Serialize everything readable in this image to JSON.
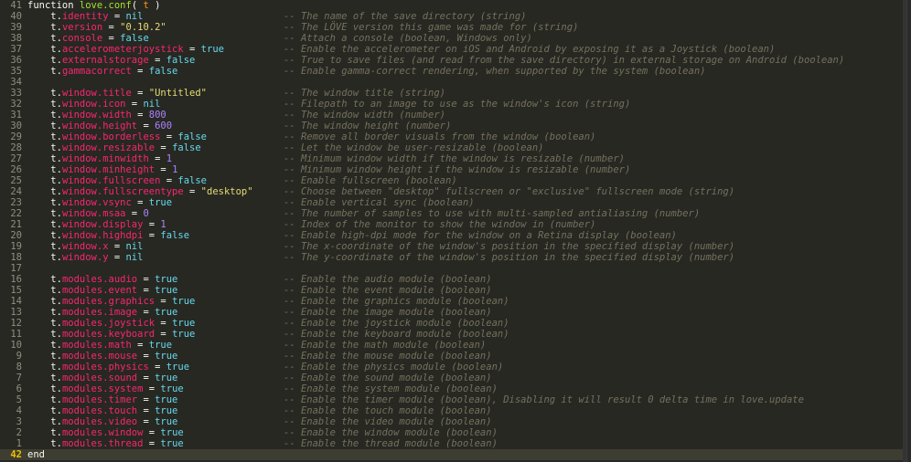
{
  "editor": {
    "lines": [
      {
        "n": "41",
        "parts": [
          {
            "c": "kw",
            "t": "function "
          },
          {
            "c": "fn",
            "t": "love.conf"
          },
          {
            "c": "kw",
            "t": "( "
          },
          {
            "c": "param",
            "t": "t"
          },
          {
            "c": "kw",
            "t": " )"
          }
        ],
        "comment": ""
      },
      {
        "n": "40",
        "parts": [
          {
            "c": "t",
            "t": "    t."
          },
          {
            "c": "key",
            "t": "identity"
          },
          {
            "c": "eq",
            "t": " = "
          },
          {
            "c": "nil",
            "t": "nil"
          }
        ],
        "comment": "-- The name of the save directory (string)"
      },
      {
        "n": "39",
        "parts": [
          {
            "c": "t",
            "t": "    t."
          },
          {
            "c": "key",
            "t": "version"
          },
          {
            "c": "eq",
            "t": " = "
          },
          {
            "c": "str",
            "t": "\"0.10.2\""
          }
        ],
        "comment": "-- The LÖVE version this game was made for (string)"
      },
      {
        "n": "38",
        "parts": [
          {
            "c": "t",
            "t": "    t."
          },
          {
            "c": "key",
            "t": "console"
          },
          {
            "c": "eq",
            "t": " = "
          },
          {
            "c": "lit",
            "t": "false"
          }
        ],
        "comment": "-- Attach a console (boolean, Windows only)"
      },
      {
        "n": "37",
        "parts": [
          {
            "c": "t",
            "t": "    t."
          },
          {
            "c": "key",
            "t": "accelerometerjoystick"
          },
          {
            "c": "eq",
            "t": " = "
          },
          {
            "c": "lit",
            "t": "true"
          }
        ],
        "comment": "-- Enable the accelerometer on iOS and Android by exposing it as a Joystick (boolean)"
      },
      {
        "n": "36",
        "parts": [
          {
            "c": "t",
            "t": "    t."
          },
          {
            "c": "key",
            "t": "externalstorage"
          },
          {
            "c": "eq",
            "t": " = "
          },
          {
            "c": "lit",
            "t": "false"
          }
        ],
        "comment": "-- True to save files (and read from the save directory) in external storage on Android (boolean)"
      },
      {
        "n": "35",
        "parts": [
          {
            "c": "t",
            "t": "    t."
          },
          {
            "c": "key",
            "t": "gammacorrect"
          },
          {
            "c": "eq",
            "t": " = "
          },
          {
            "c": "lit",
            "t": "false"
          }
        ],
        "comment": "-- Enable gamma-correct rendering, when supported by the system (boolean)"
      },
      {
        "n": "34",
        "parts": [],
        "comment": ""
      },
      {
        "n": "33",
        "parts": [
          {
            "c": "t",
            "t": "    t."
          },
          {
            "c": "key",
            "t": "window.title"
          },
          {
            "c": "eq",
            "t": " = "
          },
          {
            "c": "str",
            "t": "\"Untitled\""
          }
        ],
        "comment": "-- The window title (string)"
      },
      {
        "n": "32",
        "parts": [
          {
            "c": "t",
            "t": "    t."
          },
          {
            "c": "key",
            "t": "window.icon"
          },
          {
            "c": "eq",
            "t": " = "
          },
          {
            "c": "nil",
            "t": "nil"
          }
        ],
        "comment": "-- Filepath to an image to use as the window's icon (string)"
      },
      {
        "n": "31",
        "parts": [
          {
            "c": "t",
            "t": "    t."
          },
          {
            "c": "key",
            "t": "window.width"
          },
          {
            "c": "eq",
            "t": " = "
          },
          {
            "c": "num",
            "t": "800"
          }
        ],
        "comment": "-- The window width (number)"
      },
      {
        "n": "30",
        "parts": [
          {
            "c": "t",
            "t": "    t."
          },
          {
            "c": "key",
            "t": "window.height"
          },
          {
            "c": "eq",
            "t": " = "
          },
          {
            "c": "num",
            "t": "600"
          }
        ],
        "comment": "-- The window height (number)"
      },
      {
        "n": "29",
        "parts": [
          {
            "c": "t",
            "t": "    t."
          },
          {
            "c": "key",
            "t": "window.borderless"
          },
          {
            "c": "eq",
            "t": " = "
          },
          {
            "c": "lit",
            "t": "false"
          }
        ],
        "comment": "-- Remove all border visuals from the window (boolean)"
      },
      {
        "n": "28",
        "parts": [
          {
            "c": "t",
            "t": "    t."
          },
          {
            "c": "key",
            "t": "window.resizable"
          },
          {
            "c": "eq",
            "t": " = "
          },
          {
            "c": "lit",
            "t": "false"
          }
        ],
        "comment": "-- Let the window be user-resizable (boolean)"
      },
      {
        "n": "27",
        "parts": [
          {
            "c": "t",
            "t": "    t."
          },
          {
            "c": "key",
            "t": "window.minwidth"
          },
          {
            "c": "eq",
            "t": " = "
          },
          {
            "c": "num",
            "t": "1"
          }
        ],
        "comment": "-- Minimum window width if the window is resizable (number)"
      },
      {
        "n": "26",
        "parts": [
          {
            "c": "t",
            "t": "    t."
          },
          {
            "c": "key",
            "t": "window.minheight"
          },
          {
            "c": "eq",
            "t": " = "
          },
          {
            "c": "num",
            "t": "1"
          }
        ],
        "comment": "-- Minimum window height if the window is resizable (number)"
      },
      {
        "n": "25",
        "parts": [
          {
            "c": "t",
            "t": "    t."
          },
          {
            "c": "key",
            "t": "window.fullscreen"
          },
          {
            "c": "eq",
            "t": " = "
          },
          {
            "c": "lit",
            "t": "false"
          }
        ],
        "comment": "-- Enable fullscreen (boolean)"
      },
      {
        "n": "24",
        "parts": [
          {
            "c": "t",
            "t": "    t."
          },
          {
            "c": "key",
            "t": "window.fullscreentype"
          },
          {
            "c": "eq",
            "t": " = "
          },
          {
            "c": "str",
            "t": "\"desktop\""
          }
        ],
        "comment": "-- Choose between \"desktop\" fullscreen or \"exclusive\" fullscreen mode (string)"
      },
      {
        "n": "23",
        "parts": [
          {
            "c": "t",
            "t": "    t."
          },
          {
            "c": "key",
            "t": "window.vsync"
          },
          {
            "c": "eq",
            "t": " = "
          },
          {
            "c": "lit",
            "t": "true"
          }
        ],
        "comment": "-- Enable vertical sync (boolean)"
      },
      {
        "n": "22",
        "parts": [
          {
            "c": "t",
            "t": "    t."
          },
          {
            "c": "key",
            "t": "window.msaa"
          },
          {
            "c": "eq",
            "t": " = "
          },
          {
            "c": "num",
            "t": "0"
          }
        ],
        "comment": "-- The number of samples to use with multi-sampled antialiasing (number)"
      },
      {
        "n": "21",
        "parts": [
          {
            "c": "t",
            "t": "    t."
          },
          {
            "c": "key",
            "t": "window.display"
          },
          {
            "c": "eq",
            "t": " = "
          },
          {
            "c": "num",
            "t": "1"
          }
        ],
        "comment": "-- Index of the monitor to show the window in (number)"
      },
      {
        "n": "20",
        "parts": [
          {
            "c": "t",
            "t": "    t."
          },
          {
            "c": "key",
            "t": "window.highdpi"
          },
          {
            "c": "eq",
            "t": " = "
          },
          {
            "c": "lit",
            "t": "false"
          }
        ],
        "comment": "-- Enable high-dpi mode for the window on a Retina display (boolean)"
      },
      {
        "n": "19",
        "parts": [
          {
            "c": "t",
            "t": "    t."
          },
          {
            "c": "key",
            "t": "window.x"
          },
          {
            "c": "eq",
            "t": " = "
          },
          {
            "c": "nil",
            "t": "nil"
          }
        ],
        "comment": "-- The x-coordinate of the window's position in the specified display (number)"
      },
      {
        "n": "18",
        "parts": [
          {
            "c": "t",
            "t": "    t."
          },
          {
            "c": "key",
            "t": "window.y"
          },
          {
            "c": "eq",
            "t": " = "
          },
          {
            "c": "nil",
            "t": "nil"
          }
        ],
        "comment": "-- The y-coordinate of the window's position in the specified display (number)"
      },
      {
        "n": "17",
        "parts": [],
        "comment": ""
      },
      {
        "n": "16",
        "parts": [
          {
            "c": "t",
            "t": "    t."
          },
          {
            "c": "key",
            "t": "modules.audio"
          },
          {
            "c": "eq",
            "t": " = "
          },
          {
            "c": "lit",
            "t": "true"
          }
        ],
        "comment": "-- Enable the audio module (boolean)"
      },
      {
        "n": "15",
        "parts": [
          {
            "c": "t",
            "t": "    t."
          },
          {
            "c": "key",
            "t": "modules.event"
          },
          {
            "c": "eq",
            "t": " = "
          },
          {
            "c": "lit",
            "t": "true"
          }
        ],
        "comment": "-- Enable the event module (boolean)"
      },
      {
        "n": "14",
        "parts": [
          {
            "c": "t",
            "t": "    t."
          },
          {
            "c": "key",
            "t": "modules.graphics"
          },
          {
            "c": "eq",
            "t": " = "
          },
          {
            "c": "lit",
            "t": "true"
          }
        ],
        "comment": "-- Enable the graphics module (boolean)"
      },
      {
        "n": "13",
        "parts": [
          {
            "c": "t",
            "t": "    t."
          },
          {
            "c": "key",
            "t": "modules.image"
          },
          {
            "c": "eq",
            "t": " = "
          },
          {
            "c": "lit",
            "t": "true"
          }
        ],
        "comment": "-- Enable the image module (boolean)"
      },
      {
        "n": "12",
        "parts": [
          {
            "c": "t",
            "t": "    t."
          },
          {
            "c": "key",
            "t": "modules.joystick"
          },
          {
            "c": "eq",
            "t": " = "
          },
          {
            "c": "lit",
            "t": "true"
          }
        ],
        "comment": "-- Enable the joystick module (boolean)"
      },
      {
        "n": "11",
        "parts": [
          {
            "c": "t",
            "t": "    t."
          },
          {
            "c": "key",
            "t": "modules.keyboard"
          },
          {
            "c": "eq",
            "t": " = "
          },
          {
            "c": "lit",
            "t": "true"
          }
        ],
        "comment": "-- Enable the keyboard module (boolean)"
      },
      {
        "n": "10",
        "parts": [
          {
            "c": "t",
            "t": "    t."
          },
          {
            "c": "key",
            "t": "modules.math"
          },
          {
            "c": "eq",
            "t": " = "
          },
          {
            "c": "lit",
            "t": "true"
          }
        ],
        "comment": "-- Enable the math module (boolean)"
      },
      {
        "n": "9",
        "parts": [
          {
            "c": "t",
            "t": "    t."
          },
          {
            "c": "key",
            "t": "modules.mouse"
          },
          {
            "c": "eq",
            "t": " = "
          },
          {
            "c": "lit",
            "t": "true"
          }
        ],
        "comment": "-- Enable the mouse module (boolean)"
      },
      {
        "n": "8",
        "parts": [
          {
            "c": "t",
            "t": "    t."
          },
          {
            "c": "key",
            "t": "modules.physics"
          },
          {
            "c": "eq",
            "t": " = "
          },
          {
            "c": "lit",
            "t": "true"
          }
        ],
        "comment": "-- Enable the physics module (boolean)"
      },
      {
        "n": "7",
        "parts": [
          {
            "c": "t",
            "t": "    t."
          },
          {
            "c": "key",
            "t": "modules.sound"
          },
          {
            "c": "eq",
            "t": " = "
          },
          {
            "c": "lit",
            "t": "true"
          }
        ],
        "comment": "-- Enable the sound module (boolean)"
      },
      {
        "n": "6",
        "parts": [
          {
            "c": "t",
            "t": "    t."
          },
          {
            "c": "key",
            "t": "modules.system"
          },
          {
            "c": "eq",
            "t": " = "
          },
          {
            "c": "lit",
            "t": "true"
          }
        ],
        "comment": "-- Enable the system module (boolean)"
      },
      {
        "n": "5",
        "parts": [
          {
            "c": "t",
            "t": "    t."
          },
          {
            "c": "key",
            "t": "modules.timer"
          },
          {
            "c": "eq",
            "t": " = "
          },
          {
            "c": "lit",
            "t": "true"
          }
        ],
        "comment": "-- Enable the timer module (boolean), Disabling it will result 0 delta time in love.update"
      },
      {
        "n": "4",
        "parts": [
          {
            "c": "t",
            "t": "    t."
          },
          {
            "c": "key",
            "t": "modules.touch"
          },
          {
            "c": "eq",
            "t": " = "
          },
          {
            "c": "lit",
            "t": "true"
          }
        ],
        "comment": "-- Enable the touch module (boolean)"
      },
      {
        "n": "3",
        "parts": [
          {
            "c": "t",
            "t": "    t."
          },
          {
            "c": "key",
            "t": "modules.video"
          },
          {
            "c": "eq",
            "t": " = "
          },
          {
            "c": "lit",
            "t": "true"
          }
        ],
        "comment": "-- Enable the video module (boolean)"
      },
      {
        "n": "2",
        "parts": [
          {
            "c": "t",
            "t": "    t."
          },
          {
            "c": "key",
            "t": "modules.window"
          },
          {
            "c": "eq",
            "t": " = "
          },
          {
            "c": "lit",
            "t": "true"
          }
        ],
        "comment": "-- Enable the window module (boolean)"
      },
      {
        "n": "1",
        "parts": [
          {
            "c": "t",
            "t": "    t."
          },
          {
            "c": "key",
            "t": "modules.thread"
          },
          {
            "c": "eq",
            "t": " = "
          },
          {
            "c": "lit",
            "t": "true"
          }
        ],
        "comment": "-- Enable the thread module (boolean)"
      },
      {
        "n": "42",
        "parts": [
          {
            "c": "kw",
            "t": "end"
          }
        ],
        "comment": "",
        "current": true
      }
    ]
  }
}
